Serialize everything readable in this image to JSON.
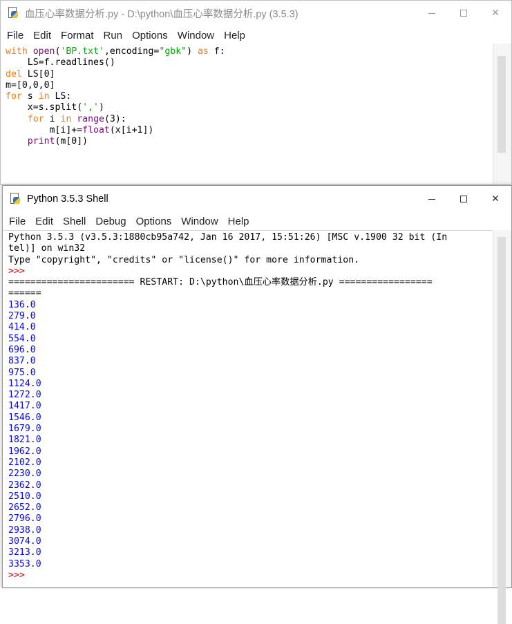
{
  "editor": {
    "title": "血压心率数据分析.py - D:\\python\\血压心率数据分析.py (3.5.3)",
    "menu": [
      "File",
      "Edit",
      "Format",
      "Run",
      "Options",
      "Window",
      "Help"
    ],
    "code_lines": [
      "with open('BP.txt',encoding=\"gbk\") as f:",
      "    LS=f.readlines()",
      "del LS[0]",
      "m=[0,0,0]",
      "for s in LS:",
      "    x=s.split(',')",
      "    for i in range(3):",
      "        m[i]+=float(x[i+1])",
      "    print(m[0])"
    ]
  },
  "shell": {
    "title": "Python 3.5.3 Shell",
    "menu": [
      "File",
      "Edit",
      "Shell",
      "Debug",
      "Options",
      "Window",
      "Help"
    ],
    "banner": [
      "Python 3.5.3 (v3.5.3:1880cb95a742, Jan 16 2017, 15:51:26) [MSC v.1900 32 bit (In",
      "tel)] on win32",
      "Type \"copyright\", \"credits\" or \"license()\" for more information."
    ],
    "prompt": ">>>",
    "restart_line": "======================= RESTART: D:\\python\\血压心率数据分析.py =================",
    "restart_line_cont": "======",
    "output": [
      "136.0",
      "279.0",
      "414.0",
      "554.0",
      "696.0",
      "837.0",
      "975.0",
      "1124.0",
      "1272.0",
      "1417.0",
      "1546.0",
      "1679.0",
      "1821.0",
      "1962.0",
      "2102.0",
      "2230.0",
      "2362.0",
      "2510.0",
      "2652.0",
      "2796.0",
      "2938.0",
      "3074.0",
      "3213.0",
      "3353.0"
    ],
    "final_prompt": ">>>"
  },
  "icons": {
    "app": "idle-python-icon",
    "minimize": "minimize-icon",
    "maximize": "maximize-icon",
    "close": "close-icon"
  },
  "colors": {
    "keyword": "#ff7700",
    "builtin": "#900090",
    "string": "#00aa00",
    "output": "#0000ff",
    "prompt": "#c00000"
  }
}
